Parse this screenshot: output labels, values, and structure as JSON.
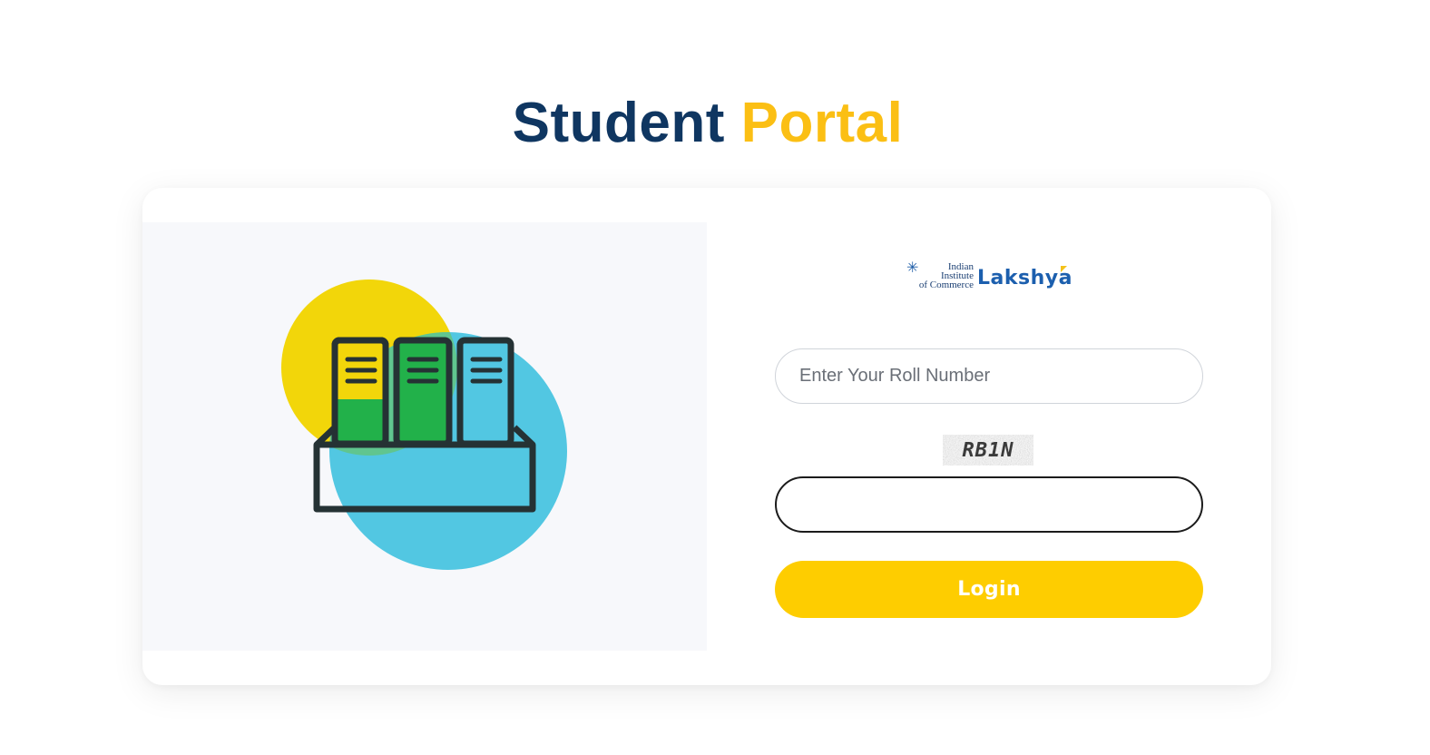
{
  "header": {
    "title_part1": "Student",
    "title_part2": "Portal"
  },
  "colors": {
    "title_primary": "#0f3661",
    "title_accent": "#fbbf14",
    "button_bg": "#fecd00",
    "logo_blue": "#1c5fae",
    "illustration_yellow": "#f2d60a",
    "illustration_blue": "#52c7e2",
    "illustration_green": "#22b14a"
  },
  "illustration": {
    "icon": "books-in-box-icon"
  },
  "logo": {
    "icon": "asterisk-star-icon",
    "line1": "Indian",
    "line2": "Institute",
    "line3": "of Commerce",
    "brand": "Lakshya"
  },
  "form": {
    "roll_placeholder": "Enter Your Roll Number",
    "roll_value": "",
    "captcha_text": "RB1N",
    "captcha_value": "",
    "login_label": "Login"
  }
}
